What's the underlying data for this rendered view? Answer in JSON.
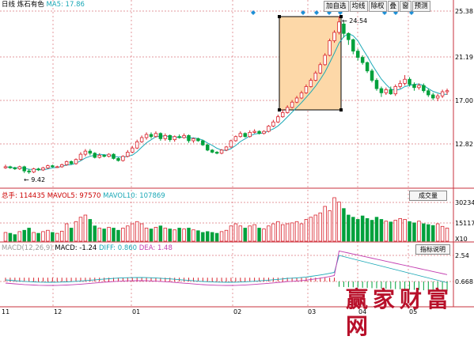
{
  "colors": {
    "up": "#d9232d",
    "down": "#00a13c",
    "ma": "#1aa8b6",
    "grid": "#c8323c",
    "accent_diamond": "#1e8fd6",
    "highlight": "#fdd8a8"
  },
  "header": {
    "period": "日线",
    "stock_name": "炼石有色",
    "ma_label": "MA5: 17.86",
    "buttons": [
      "加自选",
      "均线",
      "除权",
      "叠",
      "窗",
      "预测"
    ]
  },
  "price_axis": {
    "labels": [
      "25.38",
      "21.19",
      "17.00",
      "12.82"
    ]
  },
  "annotations": {
    "high": "24.54",
    "low": "9.42"
  },
  "volume": {
    "title": "总手: 114435",
    "ma5": "MAVOL5: 97570",
    "ma10": "MAVOL10: 107869",
    "panel_button": "成交量",
    "axis": [
      "30234",
      "15117",
      "X10"
    ]
  },
  "macd": {
    "title": "MACD(12,26,9)",
    "macd": "MACD: -1.24",
    "diff": "DIFF: 0.860",
    "dea": "DEA: 1.48",
    "panel_button": "指标说明",
    "axis": [
      "2.54",
      "0.668"
    ]
  },
  "date_axis": [
    "11",
    "12",
    "01",
    "02",
    "03",
    "04",
    "05"
  ],
  "watermark": "赢家财富网",
  "chart_data": {
    "type": "candlestick",
    "ylim": [
      8.5,
      25.5
    ],
    "candles": [
      [
        10.0,
        10.1,
        10.3,
        9.9
      ],
      [
        10.1,
        10.0,
        10.2,
        9.9
      ],
      [
        10.0,
        9.9,
        10.1,
        9.8
      ],
      [
        9.9,
        10.1,
        10.2,
        9.8
      ],
      [
        10.1,
        9.7,
        10.2,
        9.5
      ],
      [
        9.7,
        9.6,
        9.9,
        9.42
      ],
      [
        9.6,
        9.9,
        10.0,
        9.5
      ],
      [
        9.9,
        9.8,
        10.0,
        9.7
      ],
      [
        9.8,
        10.0,
        10.1,
        9.7
      ],
      [
        10.0,
        10.2,
        10.3,
        9.9
      ],
      [
        10.2,
        10.1,
        10.3,
        10.0
      ],
      [
        10.1,
        10.1,
        10.2,
        10.0
      ],
      [
        10.1,
        10.3,
        10.4,
        10.0
      ],
      [
        10.3,
        10.6,
        10.7,
        10.2
      ],
      [
        10.6,
        10.4,
        10.7,
        10.3
      ],
      [
        10.4,
        10.8,
        10.9,
        10.3
      ],
      [
        10.8,
        11.3,
        11.5,
        10.7
      ],
      [
        11.3,
        11.6,
        11.8,
        11.1
      ],
      [
        11.6,
        11.4,
        11.8,
        11.2
      ],
      [
        11.4,
        11.0,
        11.5,
        10.9
      ],
      [
        11.0,
        11.2,
        11.4,
        10.9
      ],
      [
        11.2,
        11.1,
        11.3,
        11.0
      ],
      [
        11.1,
        11.3,
        11.4,
        11.0
      ],
      [
        11.3,
        10.9,
        11.4,
        10.8
      ],
      [
        10.9,
        10.7,
        11.0,
        10.6
      ],
      [
        10.7,
        11.1,
        11.2,
        10.6
      ],
      [
        11.1,
        11.5,
        11.7,
        11.0
      ],
      [
        11.5,
        11.9,
        12.1,
        11.4
      ],
      [
        11.9,
        12.5,
        12.7,
        11.8
      ],
      [
        12.5,
        12.9,
        13.1,
        12.4
      ],
      [
        12.9,
        13.2,
        13.4,
        12.7
      ],
      [
        13.2,
        13.0,
        13.4,
        12.8
      ],
      [
        13.0,
        13.3,
        13.5,
        12.9
      ],
      [
        13.3,
        12.8,
        13.4,
        12.6
      ],
      [
        12.8,
        13.1,
        13.3,
        12.6
      ],
      [
        13.1,
        12.7,
        13.2,
        12.5
      ],
      [
        12.7,
        13.0,
        13.1,
        12.5
      ],
      [
        13.0,
        12.9,
        13.2,
        12.8
      ],
      [
        12.9,
        13.1,
        13.3,
        12.8
      ],
      [
        13.1,
        12.6,
        13.2,
        12.4
      ],
      [
        12.6,
        12.8,
        12.9,
        12.4
      ],
      [
        12.8,
        12.6,
        12.9,
        12.5
      ],
      [
        12.6,
        12.2,
        12.7,
        12.1
      ],
      [
        12.2,
        11.7,
        12.3,
        11.6
      ],
      [
        11.7,
        11.5,
        11.8,
        11.4
      ],
      [
        11.5,
        11.4,
        11.6,
        11.3
      ],
      [
        11.4,
        11.7,
        11.8,
        11.3
      ],
      [
        11.7,
        12.0,
        12.1,
        11.6
      ],
      [
        12.0,
        12.6,
        12.7,
        11.9
      ],
      [
        12.6,
        13.0,
        13.1,
        12.5
      ],
      [
        13.0,
        13.3,
        13.5,
        12.9
      ],
      [
        13.3,
        13.0,
        13.4,
        12.9
      ],
      [
        13.0,
        13.4,
        13.6,
        12.9
      ],
      [
        13.4,
        13.5,
        13.7,
        13.3
      ],
      [
        13.5,
        13.3,
        13.6,
        13.2
      ],
      [
        13.3,
        13.5,
        13.6,
        13.2
      ],
      [
        13.5,
        14.0,
        14.1,
        13.4
      ],
      [
        14.0,
        14.4,
        14.6,
        13.9
      ],
      [
        14.4,
        14.9,
        15.1,
        14.3
      ],
      [
        14.9,
        15.3,
        15.6,
        14.8
      ],
      [
        15.3,
        15.8,
        16.0,
        15.2
      ],
      [
        15.8,
        16.3,
        16.5,
        15.7
      ],
      [
        16.3,
        16.7,
        16.9,
        16.2
      ],
      [
        16.7,
        17.2,
        17.4,
        16.6
      ],
      [
        17.2,
        17.8,
        18.0,
        17.1
      ],
      [
        17.8,
        18.4,
        18.6,
        17.7
      ],
      [
        18.4,
        19.1,
        19.3,
        18.3
      ],
      [
        19.1,
        19.9,
        20.1,
        19.0
      ],
      [
        19.9,
        20.8,
        21.0,
        19.8
      ],
      [
        20.8,
        22.2,
        22.4,
        20.7
      ],
      [
        22.2,
        23.0,
        23.2,
        22.0
      ],
      [
        23.0,
        24.0,
        24.54,
        22.8
      ],
      [
        23.8,
        22.9,
        24.0,
        22.5
      ],
      [
        22.9,
        22.3,
        23.0,
        21.8
      ],
      [
        22.3,
        21.2,
        22.4,
        20.9
      ],
      [
        21.2,
        20.6,
        21.4,
        20.3
      ],
      [
        20.6,
        20.1,
        20.8,
        19.9
      ],
      [
        20.1,
        19.3,
        20.2,
        19.1
      ],
      [
        19.3,
        18.4,
        19.5,
        18.2
      ],
      [
        18.4,
        17.6,
        18.6,
        17.4
      ],
      [
        17.6,
        17.2,
        17.8,
        16.8
      ],
      [
        17.2,
        17.5,
        17.7,
        17.0
      ],
      [
        17.5,
        17.1,
        17.8,
        17.0
      ],
      [
        17.1,
        17.8,
        18.0,
        16.9
      ],
      [
        17.8,
        18.1,
        18.4,
        17.6
      ],
      [
        18.1,
        18.5,
        18.9,
        17.9
      ],
      [
        18.5,
        18.0,
        18.7,
        17.8
      ],
      [
        18.0,
        17.7,
        18.2,
        17.4
      ],
      [
        17.7,
        17.9,
        18.1,
        17.5
      ],
      [
        17.9,
        17.4,
        18.1,
        17.2
      ],
      [
        17.4,
        17.0,
        17.6,
        16.8
      ],
      [
        17.0,
        16.7,
        17.2,
        16.5
      ],
      [
        16.7,
        16.9,
        17.1,
        16.4
      ],
      [
        16.9,
        17.3,
        17.5,
        16.7
      ],
      [
        17.3,
        17.4,
        17.6,
        17.0
      ]
    ],
    "volume_ratio": [
      0.2,
      0.18,
      0.15,
      0.22,
      0.25,
      0.3,
      0.2,
      0.18,
      0.22,
      0.25,
      0.2,
      0.18,
      0.23,
      0.4,
      0.3,
      0.45,
      0.55,
      0.6,
      0.5,
      0.35,
      0.3,
      0.28,
      0.32,
      0.3,
      0.25,
      0.3,
      0.35,
      0.4,
      0.45,
      0.4,
      0.3,
      0.28,
      0.32,
      0.35,
      0.3,
      0.28,
      0.26,
      0.3,
      0.28,
      0.3,
      0.26,
      0.24,
      0.2,
      0.22,
      0.2,
      0.18,
      0.22,
      0.25,
      0.35,
      0.4,
      0.35,
      0.3,
      0.35,
      0.38,
      0.3,
      0.28,
      0.35,
      0.4,
      0.45,
      0.38,
      0.4,
      0.42,
      0.45,
      0.4,
      0.5,
      0.55,
      0.6,
      0.65,
      0.8,
      0.7,
      1.0,
      0.9,
      0.75,
      0.6,
      0.55,
      0.5,
      0.58,
      0.52,
      0.48,
      0.55,
      0.5,
      0.46,
      0.44,
      0.48,
      0.52,
      0.5,
      0.45,
      0.42,
      0.46,
      0.4,
      0.38,
      0.36,
      0.4,
      0.34,
      0.3
    ]
  }
}
